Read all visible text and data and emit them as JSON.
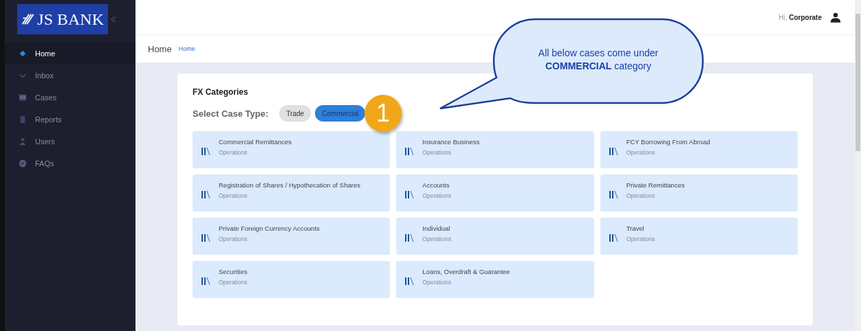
{
  "logo": {
    "text": "JS BANK"
  },
  "sidebar": {
    "items": [
      {
        "label": "Home",
        "kind": "diamond",
        "selected": true
      },
      {
        "label": "Inbox",
        "kind": "chevron",
        "selected": false
      },
      {
        "label": "Cases",
        "kind": "cases",
        "selected": false
      },
      {
        "label": "Reports",
        "kind": "report",
        "selected": false
      },
      {
        "label": "Users",
        "kind": "user",
        "selected": false
      },
      {
        "label": "FAQs",
        "kind": "chat",
        "selected": false
      }
    ]
  },
  "header": {
    "greeting": "Hi, **Corporate**"
  },
  "breadcrumb": {
    "title": "Home",
    "link": "Home"
  },
  "card": {
    "title": "FX Categories",
    "case_type_label": "Select Case Type:",
    "case_types": [
      {
        "label": "Trade",
        "selected": false
      },
      {
        "label": "Commercial",
        "selected": true
      }
    ],
    "categories": [
      {
        "title": "Commercial Remittances",
        "subtitle": "Operations"
      },
      {
        "title": "Insurance Business",
        "subtitle": "Operations"
      },
      {
        "title": "FCY Borrowing From Abroad",
        "subtitle": "Operations"
      },
      {
        "title": "Registration of Shares / Hypothecation of Shares",
        "subtitle": "Operations"
      },
      {
        "title": "Accounts",
        "subtitle": "Operations"
      },
      {
        "title": "Private Remittances",
        "subtitle": "Operations"
      },
      {
        "title": "Private Foreign Currency Accounts",
        "subtitle": "Operations"
      },
      {
        "title": "Individual",
        "subtitle": "Operations"
      },
      {
        "title": "Travel",
        "subtitle": "Operations"
      },
      {
        "title": "Securities",
        "subtitle": "Operations"
      },
      {
        "title": "Loans, Overdraft & Guarantee",
        "subtitle": "Operations"
      }
    ]
  },
  "callout": {
    "text": "All below cases come under **COMMERCIAL** category"
  },
  "step_badge": {
    "number": "1"
  }
}
